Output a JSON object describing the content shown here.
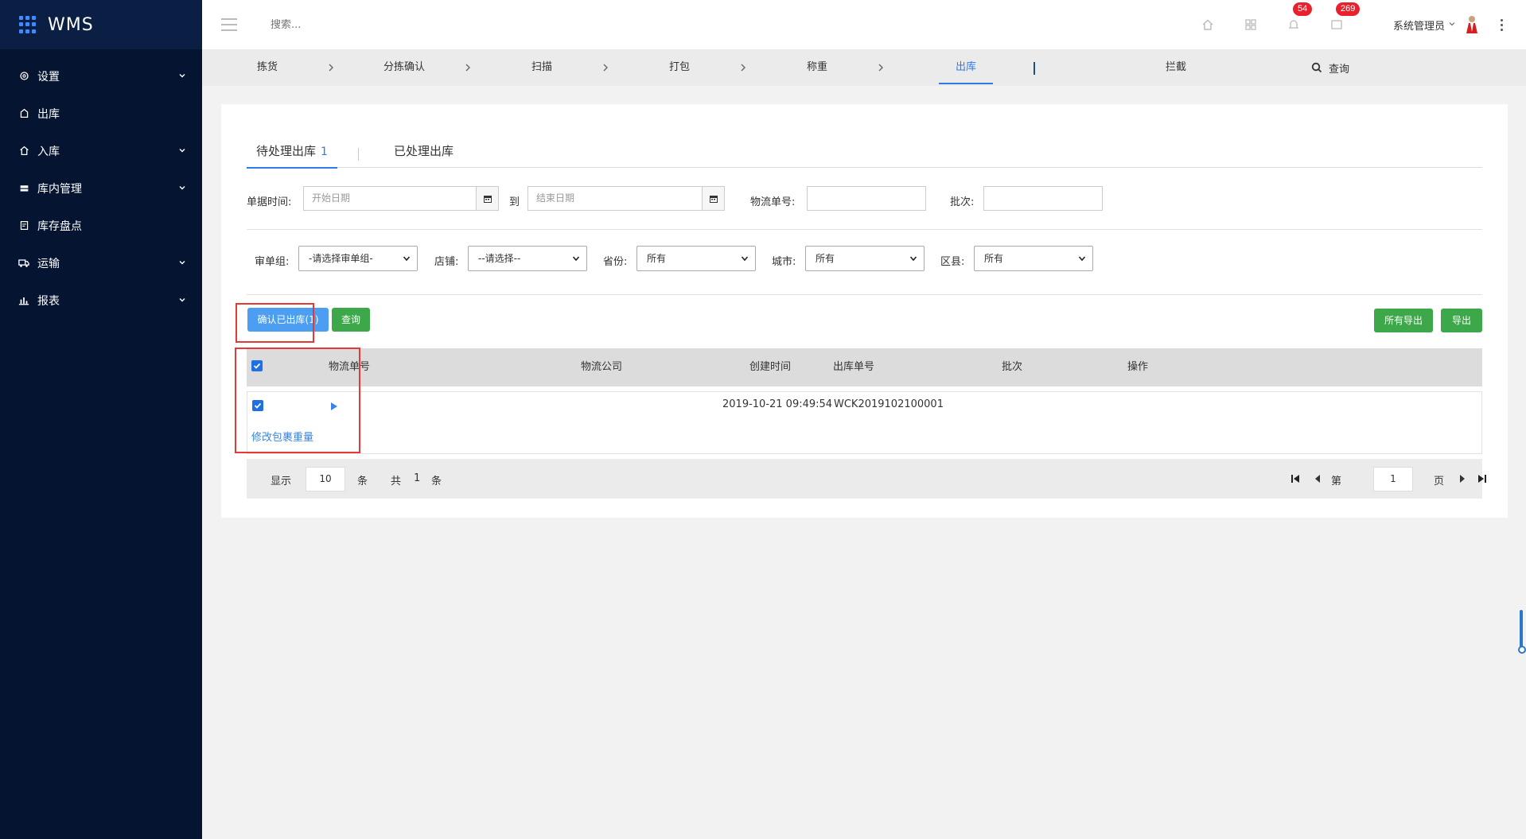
{
  "app": {
    "name": "WMS"
  },
  "sidebar": {
    "items": [
      {
        "label": "设置",
        "icon": "gear-icon",
        "has_children": true
      },
      {
        "label": "出库",
        "icon": "outbound-icon",
        "has_children": false
      },
      {
        "label": "入库",
        "icon": "inbound-icon",
        "has_children": true
      },
      {
        "label": "库内管理",
        "icon": "warehouse-icon",
        "has_children": true
      },
      {
        "label": "库存盘点",
        "icon": "inventory-icon",
        "has_children": false
      },
      {
        "label": "运输",
        "icon": "truck-icon",
        "has_children": true
      },
      {
        "label": "报表",
        "icon": "bar-chart-icon",
        "has_children": true
      }
    ]
  },
  "header": {
    "search_placeholder": "搜索...",
    "notifications_count": "54",
    "messages_count": "269",
    "user_name": "系统管理员"
  },
  "steps": {
    "items": [
      "拣货",
      "分拣确认",
      "扫描",
      "打包",
      "称重",
      "出库"
    ],
    "active": "出库",
    "intercept": "拦截",
    "query": "查询"
  },
  "tabs": {
    "pending_label": "待处理出库",
    "pending_count": "1",
    "done_label": "已处理出库"
  },
  "filters": {
    "doc_time_label": "单据时间:",
    "start_date_placeholder": "开始日期",
    "to_label": "到",
    "end_date_placeholder": "结束日期",
    "tracking_label": "物流单号:",
    "batch_label": "批次:",
    "audit_group_label": "审单组:",
    "audit_group_value": "-请选择审单组-",
    "shop_label": "店铺:",
    "shop_value": "--请选择--",
    "province_label": "省份:",
    "province_value": "所有",
    "city_label": "城市:",
    "city_value": "所有",
    "district_label": "区县:",
    "district_value": "所有"
  },
  "actions": {
    "confirm_label": "确认已出库(1)",
    "query_label": "查询",
    "export_all_label": "所有导出",
    "export_label": "导出"
  },
  "table": {
    "columns": [
      "物流单号",
      "物流公司",
      "创建时间",
      "出库单号",
      "批次",
      "操作"
    ],
    "rows": [
      {
        "tracking_no": "",
        "company": "",
        "created": "2019-10-21 09:49:54",
        "outbound_no": "WCK2019102100001",
        "batch": "",
        "action_link": "修改包裹重量"
      }
    ]
  },
  "pager": {
    "show_label": "显示",
    "page_size": "10",
    "unit": "条",
    "total_label": "共",
    "total": "1",
    "page_prefix": "第",
    "current_page": "1",
    "page_suffix": "页"
  },
  "colors": {
    "sidebar_bg": "#041431",
    "accent_blue": "#2f7be5",
    "button_green": "#3ca84a",
    "highlight_red": "#e53935",
    "badge_red": "#e7222e"
  }
}
